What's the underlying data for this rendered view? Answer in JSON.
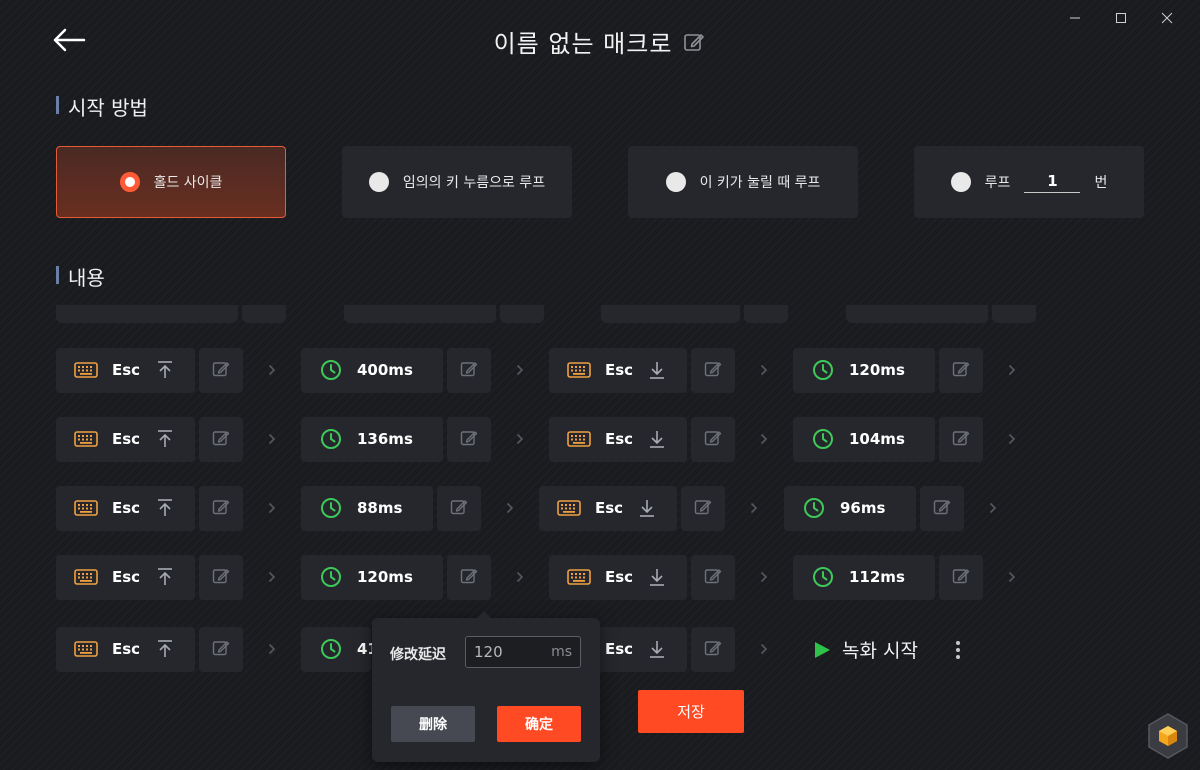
{
  "window": {
    "title": "이름 없는 매크로"
  },
  "sections": {
    "start": "시작 방법",
    "content": "내용"
  },
  "start_options": [
    {
      "label": "홀드 사이클",
      "selected": true
    },
    {
      "label": "임의의 키 누름으로 루프",
      "selected": false
    },
    {
      "label": "이 키가 눌릴 때 루프",
      "selected": false
    },
    {
      "label": "루프",
      "value": "1",
      "unit": "번",
      "selected": false
    }
  ],
  "macro_rows": [
    [
      {
        "type": "key",
        "label": "Esc",
        "dir": "up"
      },
      {
        "type": "delay",
        "label": "400ms"
      },
      {
        "type": "key",
        "label": "Esc",
        "dir": "down"
      },
      {
        "type": "delay",
        "label": "120ms"
      }
    ],
    [
      {
        "type": "key",
        "label": "Esc",
        "dir": "up"
      },
      {
        "type": "delay",
        "label": "136ms"
      },
      {
        "type": "key",
        "label": "Esc",
        "dir": "down"
      },
      {
        "type": "delay",
        "label": "104ms"
      }
    ],
    [
      {
        "type": "key",
        "label": "Esc",
        "dir": "up"
      },
      {
        "type": "delay",
        "label": "88ms"
      },
      {
        "type": "key",
        "label": "Esc",
        "dir": "down"
      },
      {
        "type": "delay",
        "label": "96ms"
      }
    ],
    [
      {
        "type": "key",
        "label": "Esc",
        "dir": "up"
      },
      {
        "type": "delay",
        "label": "120ms"
      },
      {
        "type": "key",
        "label": "Esc",
        "dir": "down"
      },
      {
        "type": "delay",
        "label": "112ms"
      }
    ],
    [
      {
        "type": "key",
        "label": "Esc",
        "dir": "up"
      },
      {
        "type": "delay",
        "label": "41"
      },
      {
        "type": "key",
        "label": "Esc",
        "dir": "down"
      }
    ]
  ],
  "record": {
    "label": "녹화 시작"
  },
  "save": {
    "label": "저장"
  },
  "popup": {
    "label": "修改延迟",
    "value": "120",
    "unit": "ms",
    "delete_label": "删除",
    "confirm_label": "确定"
  },
  "colors": {
    "accent": "#ff4a24",
    "key_icon": "#f0a040",
    "clock_icon": "#3ec85a",
    "panel": "#25272d",
    "background": "#1a1b1f"
  }
}
